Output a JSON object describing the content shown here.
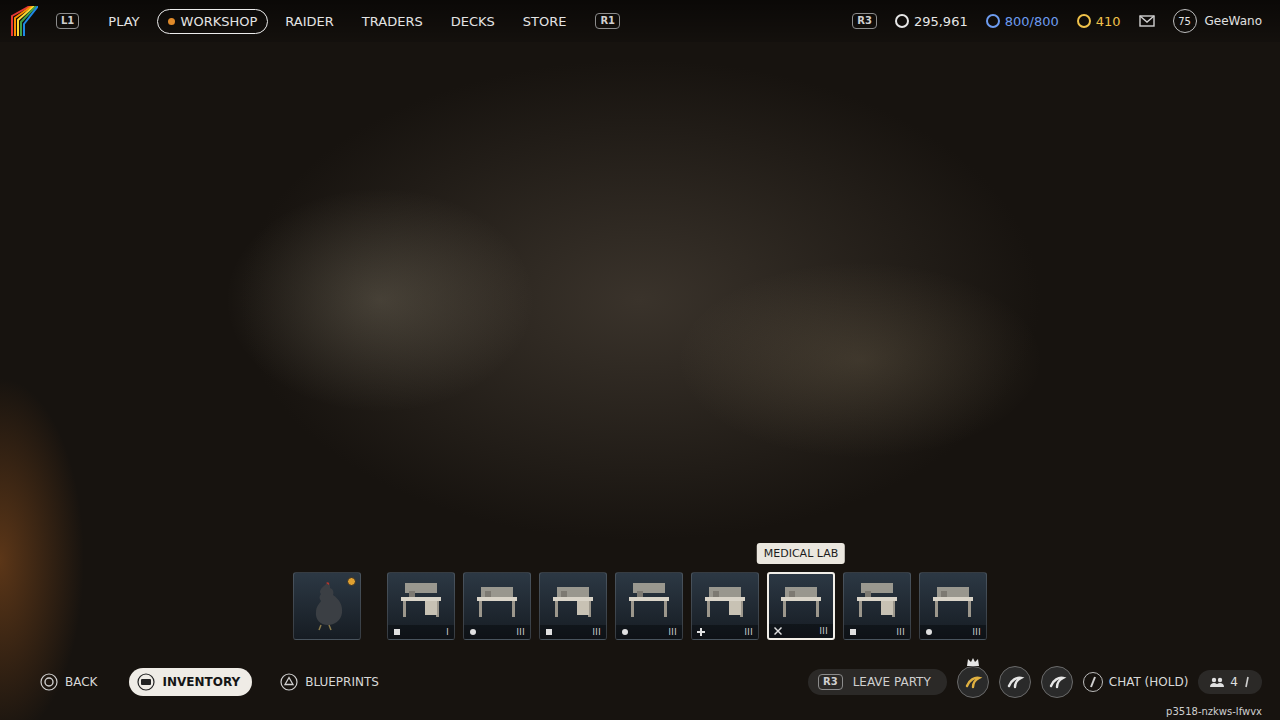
{
  "nav": {
    "left_key": "L1",
    "right_key": "R1",
    "tabs": [
      {
        "label": "PLAY",
        "selected": false
      },
      {
        "label": "WORKSHOP",
        "selected": true
      },
      {
        "label": "RAIDER",
        "selected": false
      },
      {
        "label": "TRADERS",
        "selected": false
      },
      {
        "label": "DECKS",
        "selected": false
      },
      {
        "label": "STORE",
        "selected": false
      }
    ]
  },
  "status": {
    "key": "R3",
    "currencies": [
      {
        "value": "295,961",
        "color": "#e6e6e6"
      },
      {
        "value": "800/800",
        "color": "#6d9cf0"
      },
      {
        "value": "410",
        "color": "#f0c24a"
      }
    ],
    "player": {
      "level": "75",
      "name": "GeeWano"
    }
  },
  "tooltip": "MEDICAL LAB",
  "pet": {
    "selected": false,
    "badge": true
  },
  "benches": [
    {
      "level": "I",
      "selected": false
    },
    {
      "level": "III",
      "selected": false
    },
    {
      "level": "III",
      "selected": false
    },
    {
      "level": "III",
      "selected": false
    },
    {
      "level": "III",
      "selected": false
    },
    {
      "level": "III",
      "selected": true
    },
    {
      "level": "III",
      "selected": false
    },
    {
      "level": "III",
      "selected": false
    }
  ],
  "hints": [
    {
      "label": "BACK",
      "selected": false
    },
    {
      "label": "INVENTORY",
      "selected": true
    },
    {
      "label": "BLUEPRINTS",
      "selected": false
    }
  ],
  "party": {
    "key": "R3",
    "leave": "LEAVE PARTY",
    "members": [
      {
        "leader": true
      },
      {
        "leader": false
      },
      {
        "leader": false
      }
    ],
    "chat": "CHAT (HOLD)",
    "count": "4",
    "session": "p3518-nzkws-lfwvx"
  }
}
